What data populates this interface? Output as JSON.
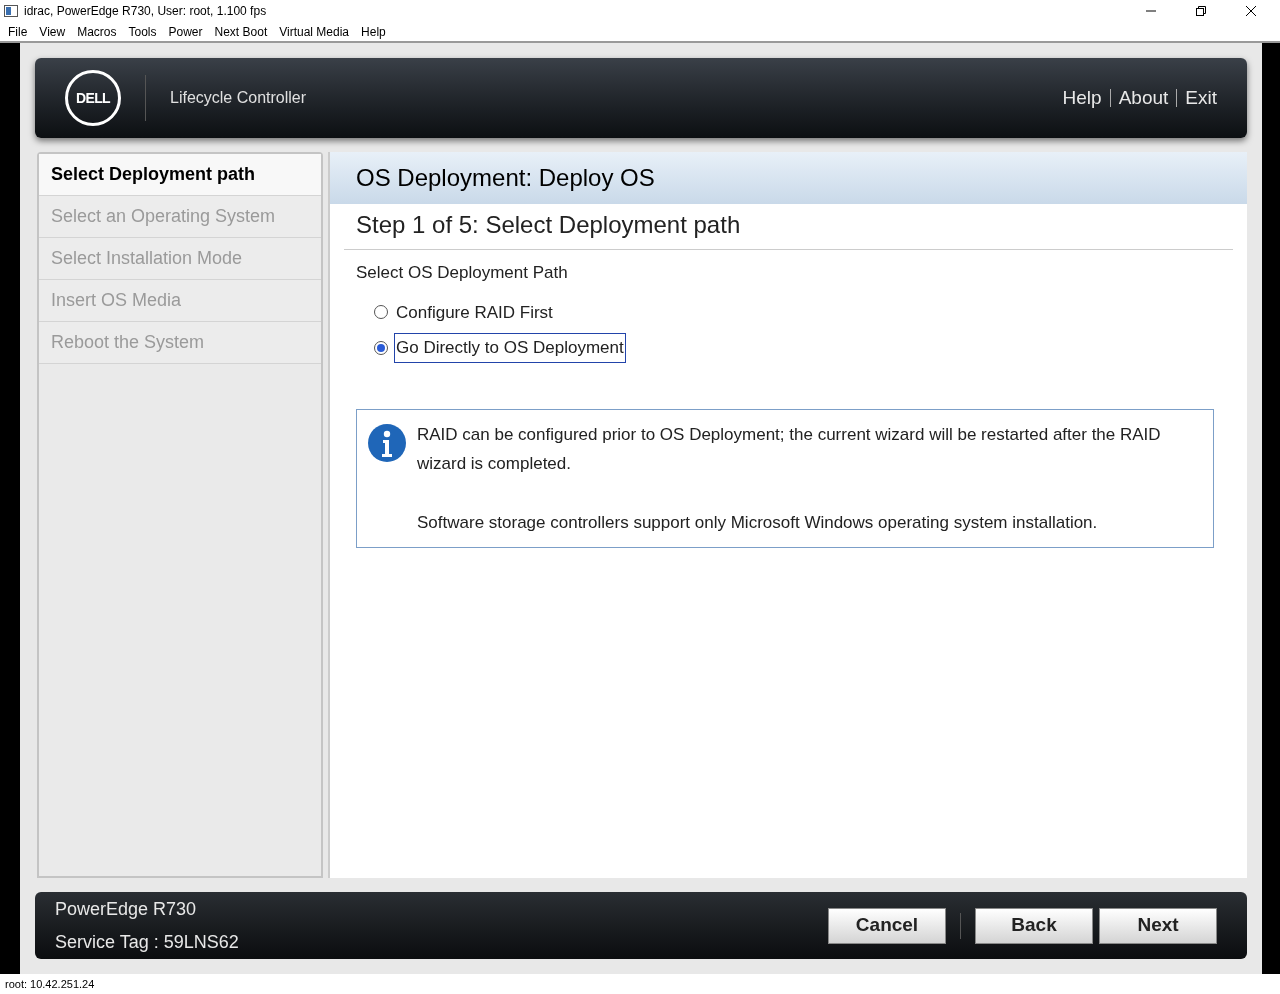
{
  "window": {
    "title": "idrac, PowerEdge R730, User: root, 1.100 fps"
  },
  "menu": [
    "File",
    "View",
    "Macros",
    "Tools",
    "Power",
    "Next Boot",
    "Virtual Media",
    "Help"
  ],
  "header": {
    "logo": "DELL",
    "product": "Lifecycle Controller",
    "links": [
      "Help",
      "About",
      "Exit"
    ]
  },
  "steps": [
    {
      "label": "Select Deployment path",
      "selected": true
    },
    {
      "label": "Select an Operating System",
      "selected": false
    },
    {
      "label": "Select Installation Mode",
      "selected": false
    },
    {
      "label": "Insert OS Media",
      "selected": false
    },
    {
      "label": "Reboot the System",
      "selected": false
    }
  ],
  "panel": {
    "title": "OS Deployment: Deploy OS",
    "step_title": "Step 1 of 5: Select Deployment path",
    "group_label": "Select OS Deployment Path",
    "options": [
      {
        "label": "Configure RAID First",
        "selected": false
      },
      {
        "label": "Go Directly to OS Deployment",
        "selected": true
      }
    ],
    "info": [
      "RAID can be configured prior to OS Deployment; the current wizard will be restarted after the RAID wizard is completed.",
      "Software storage controllers support only Microsoft Windows operating system installation."
    ]
  },
  "footer": {
    "model": "PowerEdge R730",
    "service_tag": "Service Tag : 59LNS62",
    "buttons": [
      "Cancel",
      "Back",
      "Next"
    ]
  },
  "status_bar": "root: 10.42.251.24"
}
